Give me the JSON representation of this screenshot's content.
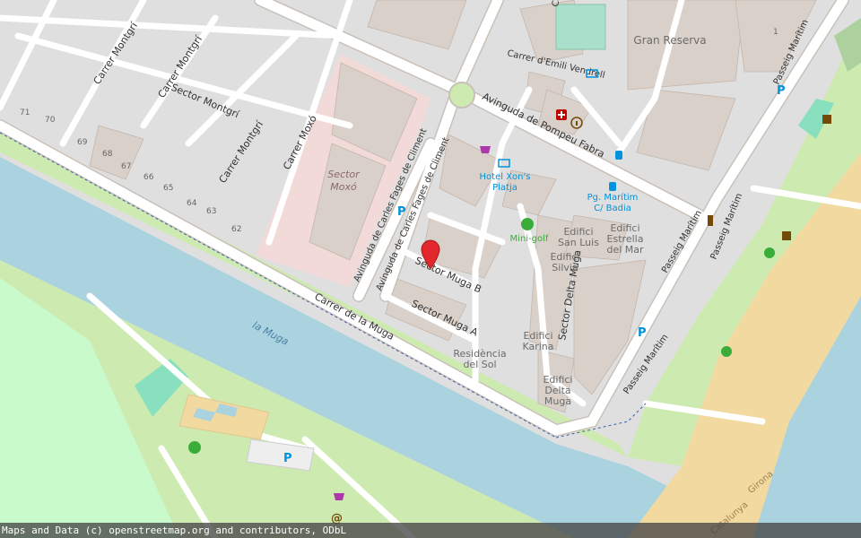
{
  "map": {
    "attribution": "Maps and Data (c) openstreetmap.org and contributors, ODbL",
    "colors": {
      "background": "#f2efe9",
      "residential": "#e0dfdf",
      "water": "#aad3df",
      "park": "#c8facc",
      "grass": "#cdebb0",
      "sand": "#f1d9a0",
      "road": "#ffffff",
      "road_casing": "#c9c1b8",
      "building": "#d9d0c9",
      "highlight_area": "#f2dad9",
      "marker": "#e2282c",
      "poi_blue": "#0092da",
      "poi_magenta": "#ac39ac",
      "poi_green": "#39ac39",
      "poi_brown": "#734a08",
      "poi_red": "#bf0000"
    },
    "labels": {
      "carrer_montgri_1": "Carrer Montgrí",
      "carrer_montgri_2": "Carrer Montgrí",
      "carrer_montgri_3": "Carrer Montgrí",
      "sector_montgri": "Sector Montgrí",
      "carrer_moxo": "Carrer Moxó",
      "sector_moxo_1": "Sector",
      "sector_moxo_2": "Moxó",
      "av_carles_fages_1": "Avinguda de Carles Fages de Climent",
      "av_carles_fages_2": "Avinguda de Carles Fages de Climent",
      "carrer_de_la_muga": "Carrer de la Muga",
      "la_muga": "la Muga",
      "carrer_emili_vendrell": "Carrer d'Emili Vendrell",
      "gran_reserva": "Gran Reserva",
      "av_pompeu_fabra": "Avinguda de Pompeu Fabra",
      "hotel_xons_1": "Hotel Xon's",
      "hotel_xons_2": "Platja",
      "pg_maritim_stop_1": "Pg. Marítim",
      "pg_maritim_stop_2": "C/ Badia",
      "mini_golf": "Mini-golf",
      "edifici_san_luis_1": "Edifici",
      "edifici_san_luis_2": "San Luis",
      "edifici_estrella_1": "Edifici",
      "edifici_estrella_2": "Estrella",
      "edifici_estrella_3": "del Mar",
      "edifici_silvia_1": "Edifici",
      "edifici_silvia_2": "Silvia",
      "sector_muga_b": "Sector Muga B",
      "sector_muga_a": "Sector Muga A",
      "sector_delta_muga": "Sector Delta Muga",
      "edifici_karina_1": "Edifici",
      "edifici_karina_2": "Karina",
      "residencia_1": "Residència",
      "residencia_2": "del Sol",
      "edifici_delta_1": "Edifici",
      "edifici_delta_2": "Delta",
      "edifici_delta_3": "Muga",
      "passeig_maritim_1": "Passeig Marítim",
      "passeig_maritim_2": "Passeig Marítim",
      "passeig_maritim_3": "Passeig Marítim",
      "passeig_maritim_4": "Passeig Marítim",
      "catalunya": "Catalunya",
      "girona": "Girona",
      "hn_71": "71",
      "hn_70": "70",
      "hn_69": "69",
      "hn_68": "68",
      "hn_67": "67",
      "hn_66": "66",
      "hn_65": "65",
      "hn_64": "64",
      "hn_63": "63",
      "hn_62": "62",
      "hn_1": "1",
      "partial_ca": "Ca"
    },
    "icons": {
      "parking": "P",
      "hotel": "hotel-icon",
      "pharmacy": "pharmacy-icon",
      "info": "information-icon",
      "bus": "bus-stop-icon",
      "shop": "shop-icon",
      "minigolf": "minigolf-icon",
      "playground": "playground-icon",
      "drinking_water": "drinking-water-icon",
      "toilet": "toilets-icon",
      "internet": "@"
    },
    "marker": "location-pin-icon"
  }
}
